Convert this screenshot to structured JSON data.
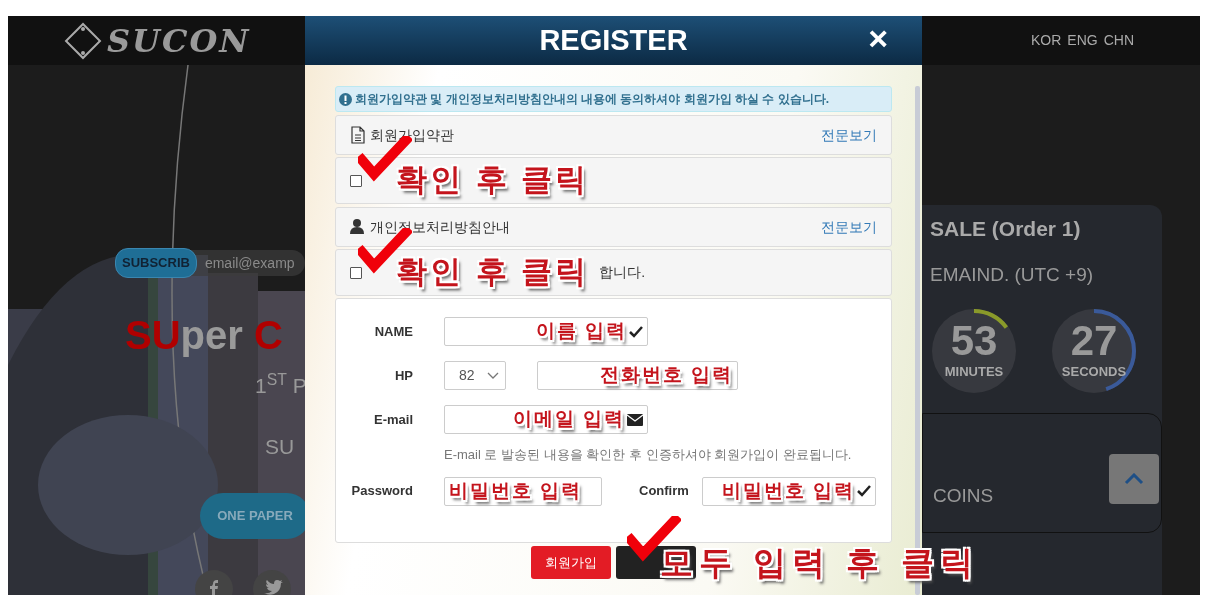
{
  "header": {
    "logo": "SUCON",
    "languages": [
      {
        "label": "KOR"
      },
      {
        "label": "ENG"
      },
      {
        "label": "CHN"
      }
    ]
  },
  "background_left": {
    "subscribe_button": "SUBSCRIB",
    "email_placeholder": "email@examp",
    "headline": [
      {
        "text": "SU",
        "accent": true
      },
      {
        "text": "per ",
        "accent": false
      },
      {
        "text": "C",
        "accent": true
      }
    ],
    "subtitle": "1$^{ST}$ P",
    "line": "SU",
    "paper_button": "ONE PAPER",
    "social_icons": [
      {
        "kind": "letter"
      },
      {
        "kind": "bird"
      }
    ]
  },
  "background_right": {
    "sale_title": "SALE (Order 1)",
    "remaining": "EMAIND. (UTC +9)",
    "timers": [
      {
        "value": "53",
        "unit": "MINUTES",
        "level": 0.15,
        "color": "#8a9a2a"
      },
      {
        "value": "27",
        "unit": "SECONDS",
        "level": 0.45,
        "color": "#3a5a9a"
      }
    ],
    "coins": "COINS"
  },
  "modal": {
    "title": "REGISTER",
    "close": "×",
    "notice": "회원가입약관 및 개인정보처리방침안내의 내용에 동의하셔야 회원가입 하실 수 있습니다.",
    "agreements": [
      {
        "kind": "terms",
        "title": "회원가입약관",
        "link": "전문보기",
        "checked": false,
        "annotation": "확인 후 클릭"
      },
      {
        "kind": "privacy",
        "title": "개인정보처리방침안내",
        "link": "전문보기",
        "checked": false,
        "label_tail": "합니다.",
        "annotation": "확인 후 클릭"
      }
    ],
    "fields": [
      {
        "kind": "name",
        "label": "NAME",
        "annotation": "이름 입력"
      },
      {
        "kind": "phone",
        "label": "HP",
        "country_code": "82",
        "annotation": "전화번호 입력"
      },
      {
        "kind": "email",
        "label": "E-mail",
        "annotation": "이메일 입력"
      },
      {
        "kind": "help",
        "text": "E-mail 로 발송된 내용을 확인한 후 인증하셔야 회원가입이 완료됩니다."
      },
      {
        "kind": "password",
        "label": "Password",
        "annotation": "비밀번호 입력",
        "confirm_label": "Confirm",
        "confirm_annotation": "비밀번호 입력"
      }
    ],
    "submit_button": "회원가입",
    "submit_annotation": "모두 입력 후 클릭"
  }
}
